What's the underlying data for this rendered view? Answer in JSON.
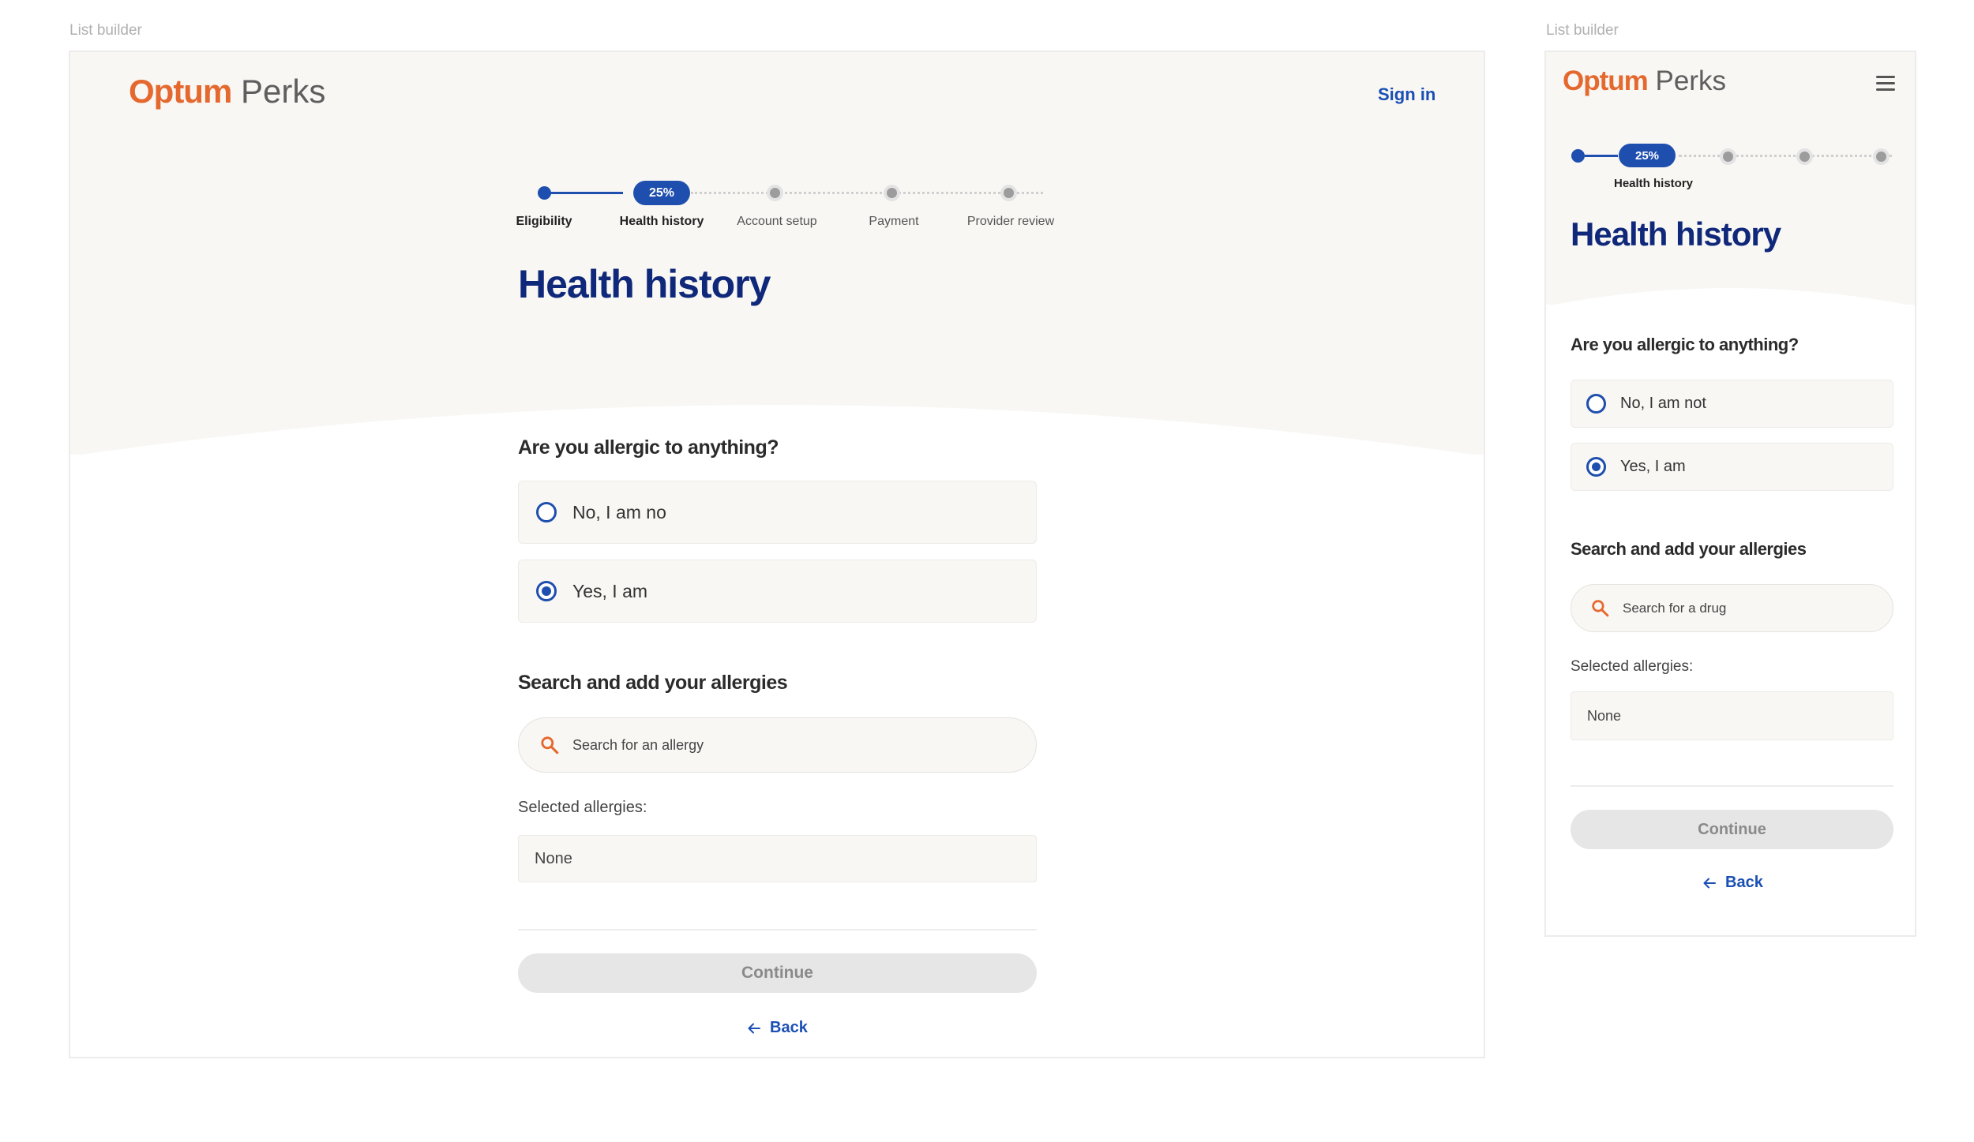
{
  "frame_label": "List builder",
  "brand": {
    "optum": "Optum",
    "perks": "Perks"
  },
  "colors": {
    "brand_orange": "#e5682e",
    "primary_blue": "#1e4fae",
    "title_navy": "#10287a",
    "hero_bg": "#f8f7f4"
  },
  "desktop": {
    "sign_in": "Sign in",
    "stepper": {
      "progress_badge": "25%",
      "steps": [
        "Eligibility",
        "Health history",
        "Account setup",
        "Payment",
        "Provider review"
      ],
      "current": "Health history"
    },
    "title": "Health history",
    "question": "Are you allergic to anything?",
    "options": [
      {
        "label": "No, I am no",
        "selected": false
      },
      {
        "label": "Yes, I am",
        "selected": true
      }
    ],
    "search_heading": "Search and add your allergies",
    "search_placeholder": "Search for an allergy",
    "selected_label": "Selected allergies:",
    "selected_value": "None",
    "continue_label": "Continue",
    "back_label": "Back"
  },
  "mobile": {
    "menu_icon": "hamburger-menu-icon",
    "stepper": {
      "progress_badge": "25%",
      "current_label": "Health history"
    },
    "title": "Health history",
    "question": "Are you allergic to anything?",
    "options": [
      {
        "label": "No, I am not",
        "selected": false
      },
      {
        "label": "Yes, I am",
        "selected": true
      }
    ],
    "search_heading": "Search and add your allergies",
    "search_placeholder": "Search for a drug",
    "selected_label": "Selected allergies:",
    "selected_value": "None",
    "continue_label": "Continue",
    "back_label": "Back"
  }
}
